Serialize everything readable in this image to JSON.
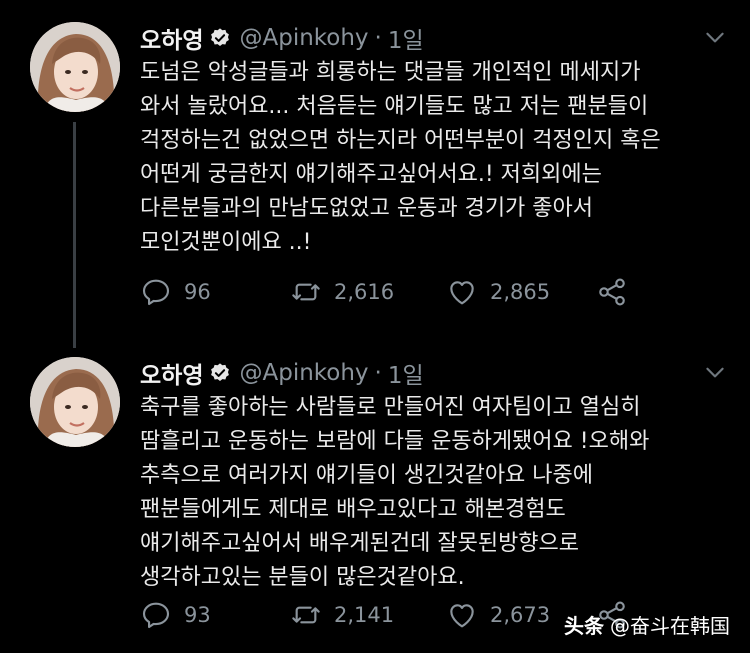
{
  "tweets": [
    {
      "author_name": "오하영",
      "handle": "@Apinkohy",
      "separator": "·",
      "time": "1일",
      "text": "도넘은 악성글들과 희롱하는 댓글들 개인적인 메세지가\n와서 놀랐어요... 처음듣는 얘기들도 많고 저는 팬분들이\n걱정하는건 없었으면 하는지라 어떤부분이 걱정인지 혹은\n어떤게 궁금한지 얘기해주고싶어서요.! 저희외에는\n다른분들과의 만남도없었고 운동과 경기가 좋아서\n모인것뿐이에요 ..!",
      "replies": "96",
      "retweets": "2,616",
      "likes": "2,865"
    },
    {
      "author_name": "오하영",
      "handle": "@Apinkohy",
      "separator": "·",
      "time": "1일",
      "text": "축구를 좋아하는 사람들로 만들어진 여자팀이고 열심히\n땀흘리고 운동하는 보람에 다들 운동하게됐어요 !오해와\n추측으로 여러가지 얘기들이 생긴것같아요 나중에\n팬분들에게도 제대로 배우고있다고 해본경험도\n얘기해주고싶어서 배우게된건데 잘못된방향으로\n생각하고있는 분들이 많은것같아요.",
      "replies": "93",
      "retweets": "2,141",
      "likes": "2,673"
    }
  ],
  "watermark": {
    "brand": "头条",
    "account": "@奋斗在韩国"
  },
  "colors": {
    "background": "#000000",
    "text": "#eaeaea",
    "muted": "#8b949c",
    "verified_badge": "#e6e6e6",
    "thread_line": "#3a3f44"
  },
  "icons": [
    "verified-badge-icon",
    "chevron-down-icon",
    "reply-icon",
    "retweet-icon",
    "like-icon",
    "share-icon"
  ]
}
